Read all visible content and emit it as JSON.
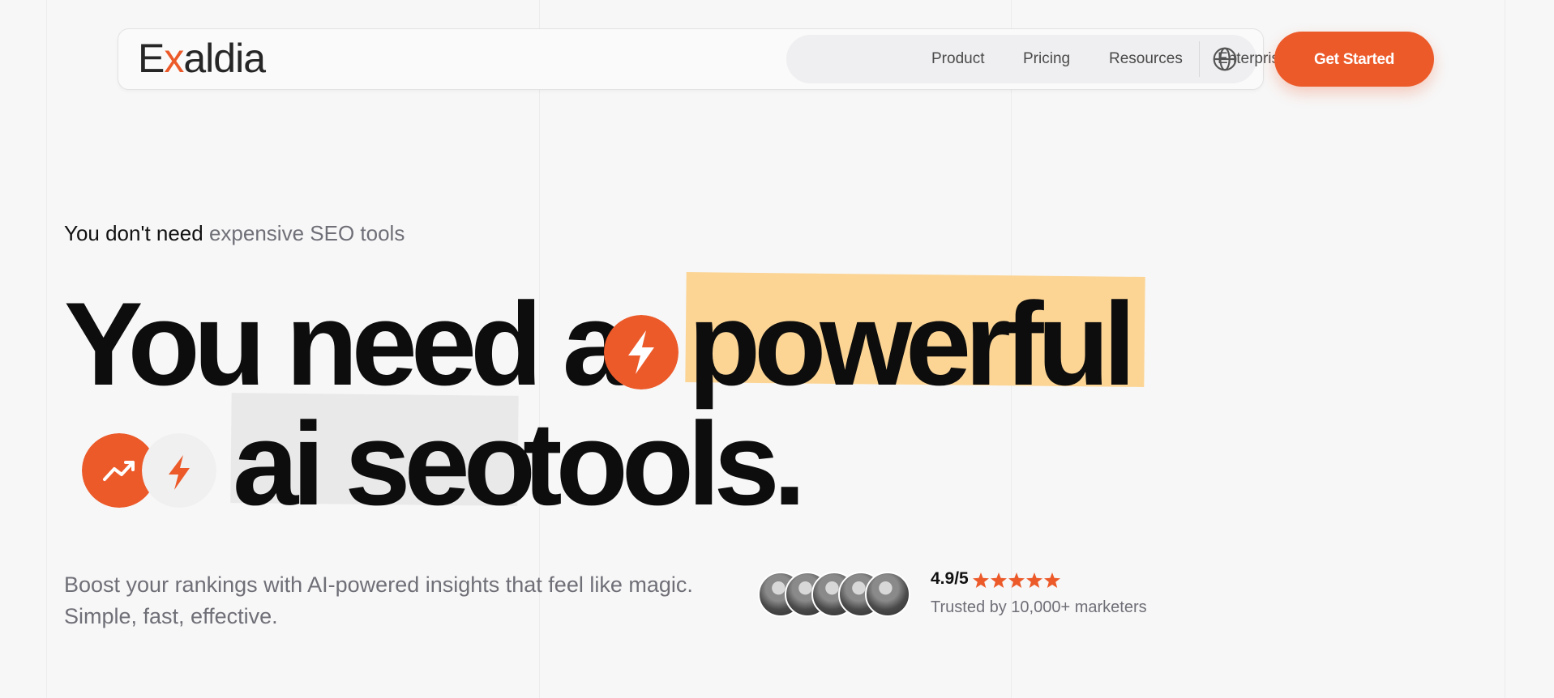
{
  "brand": {
    "logo_prefix": "E",
    "logo_x": "x",
    "logo_suffix": "aldia",
    "accent": "#ec5a2a"
  },
  "nav": {
    "items": [
      {
        "label": "Product"
      },
      {
        "label": "Pricing"
      },
      {
        "label": "Resources"
      },
      {
        "label": "Enterprise"
      }
    ],
    "language_icon": "globe-icon",
    "cta_label": "Get Started"
  },
  "hero": {
    "eyebrow_dark": "You don't need",
    "eyebrow_light": "expensive SEO tools",
    "line1_start": "You need a",
    "line1_highlight": "powerful",
    "line2_highlight": "ai seo",
    "line2_end": "tools.",
    "badge_icons": [
      "bolt-icon",
      "trending-up-icon",
      "bolt-icon"
    ],
    "highlight_colors": {
      "orange": "#fcd595",
      "gray": "#e9e9e9"
    },
    "subtitle": "Boost your rankings with AI-powered insights that feel like magic. Simple, fast, effective."
  },
  "social_proof": {
    "rating": "4.9/5",
    "stars": 5,
    "trusted": "Trusted by 10,000+ marketers"
  }
}
